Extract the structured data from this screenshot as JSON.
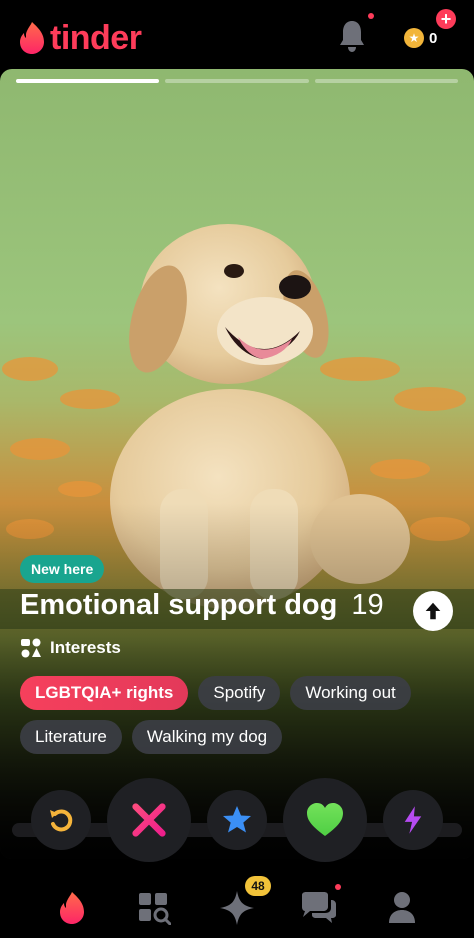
{
  "header": {
    "logo_text": "tinder",
    "coin_count": "0",
    "brand_color": "#fe3c5a"
  },
  "card": {
    "photo_count": 3,
    "active_photo": 1,
    "badge": "New here",
    "name": "Emotional support dog",
    "age": "19",
    "interests_label": "Interests",
    "interests": [
      "LGBTQIA+ rights",
      "Spotify",
      "Working out",
      "Literature",
      "Walking my dog"
    ]
  },
  "actions": [
    {
      "name": "rewind",
      "icon": "rewind-icon"
    },
    {
      "name": "nope",
      "icon": "x-icon"
    },
    {
      "name": "super-like",
      "icon": "star-icon"
    },
    {
      "name": "like",
      "icon": "heart-icon"
    },
    {
      "name": "boost",
      "icon": "lightning-icon"
    }
  ],
  "nav": {
    "items": [
      "flame-icon",
      "explore-icon",
      "sparkle-icon",
      "chat-icon",
      "profile-icon"
    ],
    "likes_badge": "48"
  }
}
